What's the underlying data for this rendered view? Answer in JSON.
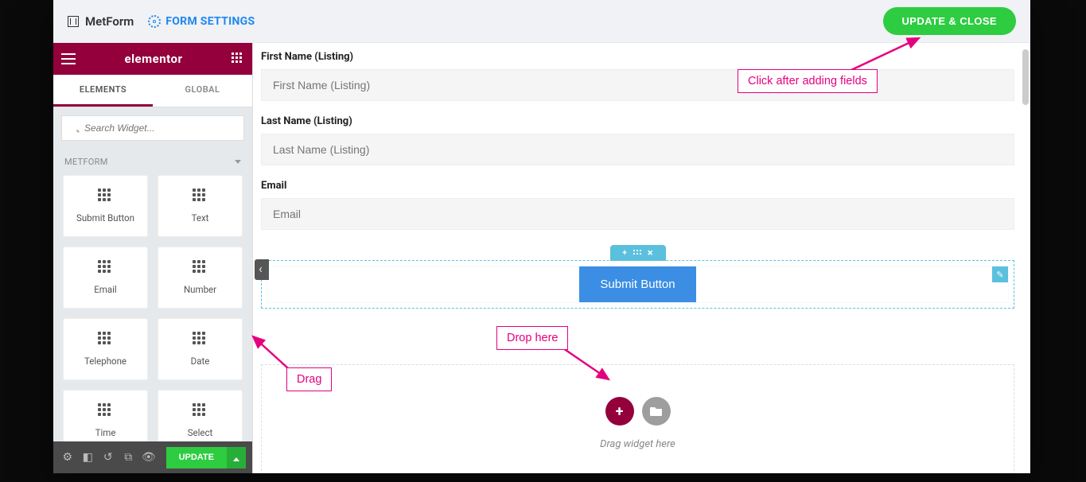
{
  "topbar": {
    "brand": "MetForm",
    "form_settings": "FORM SETTINGS",
    "update_close": "UPDATE & CLOSE"
  },
  "sidebar": {
    "logo": "elementor",
    "tabs": {
      "elements": "ELEMENTS",
      "global": "GLOBAL"
    },
    "search_placeholder": "Search Widget...",
    "category": "METFORM",
    "widgets": [
      "Submit Button",
      "Text",
      "Email",
      "Number",
      "Telephone",
      "Date",
      "Time",
      "Select"
    ],
    "footer": {
      "update": "UPDATE"
    }
  },
  "preview": {
    "fields": [
      {
        "label": "First Name (Listing)",
        "placeholder": "First Name (Listing)"
      },
      {
        "label": "Last Name (Listing)",
        "placeholder": "Last Name (Listing)"
      },
      {
        "label": "Email",
        "placeholder": "Email"
      }
    ],
    "submit_label": "Submit Button",
    "dropzone_text": "Drag widget here"
  },
  "annotations": {
    "click_after": "Click after adding fields",
    "drag": "Drag",
    "drop_here": "Drop here"
  }
}
